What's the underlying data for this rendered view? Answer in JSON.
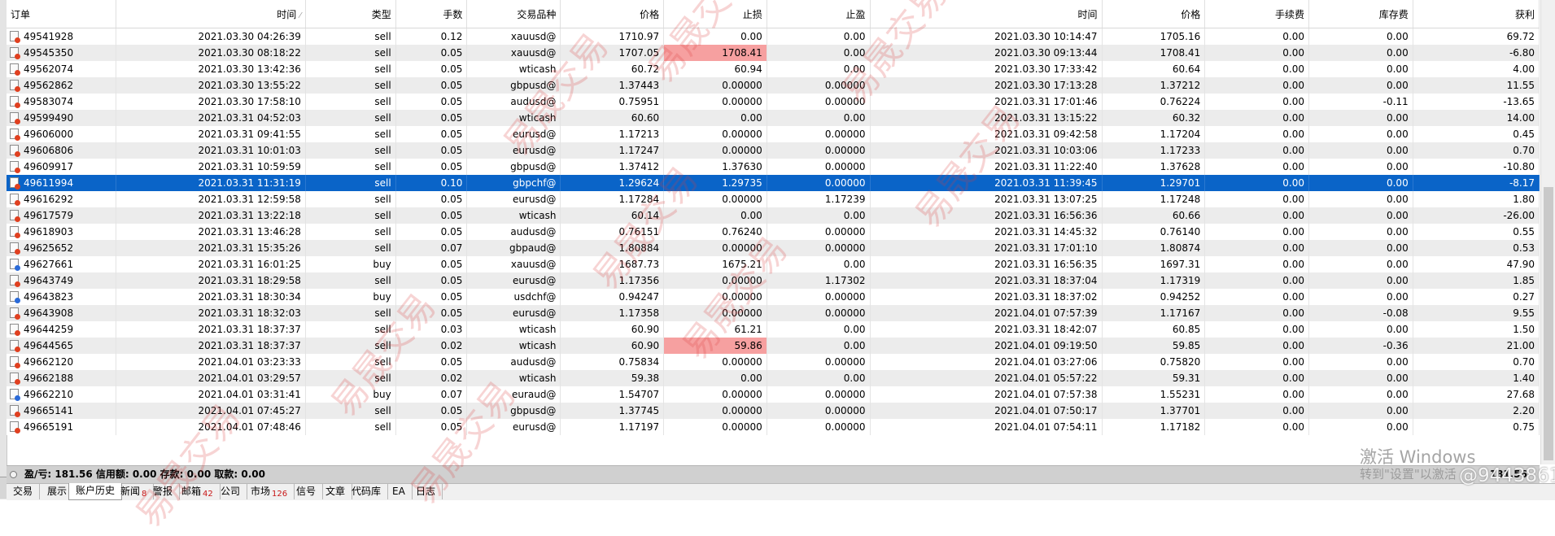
{
  "table": {
    "columns": [
      "订单",
      "时间",
      "类型",
      "手数",
      "交易品种",
      "价格",
      "止损",
      "止盈",
      "时间",
      "价格",
      "手续费",
      "库存费",
      "获利"
    ],
    "rows": [
      {
        "order": "49541928",
        "open_time": "2021.03.30 04:26:39",
        "type": "sell",
        "lots": "0.12",
        "symbol": "xauusd@",
        "open_price": "1710.97",
        "sl": "0.00",
        "tp": "0.00",
        "close_time": "2021.03.30 10:14:47",
        "close_price": "1705.16",
        "commission": "0.00",
        "swap": "0.00",
        "profit": "69.72"
      },
      {
        "order": "49545350",
        "open_time": "2021.03.30 08:18:22",
        "type": "sell",
        "lots": "0.05",
        "symbol": "xauusd@",
        "open_price": "1707.05",
        "sl": "1708.41",
        "tp": "0.00",
        "close_time": "2021.03.30 09:13:44",
        "close_price": "1708.41",
        "commission": "0.00",
        "swap": "0.00",
        "profit": "-6.80",
        "sl_hit": true
      },
      {
        "order": "49562074",
        "open_time": "2021.03.30 13:42:36",
        "type": "sell",
        "lots": "0.05",
        "symbol": "wticash",
        "open_price": "60.72",
        "sl": "60.94",
        "tp": "0.00",
        "close_time": "2021.03.30 17:33:42",
        "close_price": "60.64",
        "commission": "0.00",
        "swap": "0.00",
        "profit": "4.00"
      },
      {
        "order": "49562862",
        "open_time": "2021.03.30 13:55:22",
        "type": "sell",
        "lots": "0.05",
        "symbol": "gbpusd@",
        "open_price": "1.37443",
        "sl": "0.00000",
        "tp": "0.00000",
        "close_time": "2021.03.30 17:13:28",
        "close_price": "1.37212",
        "commission": "0.00",
        "swap": "0.00",
        "profit": "11.55"
      },
      {
        "order": "49583074",
        "open_time": "2021.03.30 17:58:10",
        "type": "sell",
        "lots": "0.05",
        "symbol": "audusd@",
        "open_price": "0.75951",
        "sl": "0.00000",
        "tp": "0.00000",
        "close_time": "2021.03.31 17:01:46",
        "close_price": "0.76224",
        "commission": "0.00",
        "swap": "-0.11",
        "profit": "-13.65"
      },
      {
        "order": "49599490",
        "open_time": "2021.03.31 04:52:03",
        "type": "sell",
        "lots": "0.05",
        "symbol": "wticash",
        "open_price": "60.60",
        "sl": "0.00",
        "tp": "0.00",
        "close_time": "2021.03.31 13:15:22",
        "close_price": "60.32",
        "commission": "0.00",
        "swap": "0.00",
        "profit": "14.00"
      },
      {
        "order": "49606000",
        "open_time": "2021.03.31 09:41:55",
        "type": "sell",
        "lots": "0.05",
        "symbol": "eurusd@",
        "open_price": "1.17213",
        "sl": "0.00000",
        "tp": "0.00000",
        "close_time": "2021.03.31 09:42:58",
        "close_price": "1.17204",
        "commission": "0.00",
        "swap": "0.00",
        "profit": "0.45"
      },
      {
        "order": "49606806",
        "open_time": "2021.03.31 10:01:03",
        "type": "sell",
        "lots": "0.05",
        "symbol": "eurusd@",
        "open_price": "1.17247",
        "sl": "0.00000",
        "tp": "0.00000",
        "close_time": "2021.03.31 10:03:06",
        "close_price": "1.17233",
        "commission": "0.00",
        "swap": "0.00",
        "profit": "0.70"
      },
      {
        "order": "49609917",
        "open_time": "2021.03.31 10:59:59",
        "type": "sell",
        "lots": "0.05",
        "symbol": "gbpusd@",
        "open_price": "1.37412",
        "sl": "1.37630",
        "tp": "0.00000",
        "close_time": "2021.03.31 11:22:40",
        "close_price": "1.37628",
        "commission": "0.00",
        "swap": "0.00",
        "profit": "-10.80"
      },
      {
        "order": "49611994",
        "open_time": "2021.03.31 11:31:19",
        "type": "sell",
        "lots": "0.10",
        "symbol": "gbpchf@",
        "open_price": "1.29624",
        "sl": "1.29735",
        "tp": "0.00000",
        "close_time": "2021.03.31 11:39:45",
        "close_price": "1.29701",
        "commission": "0.00",
        "swap": "0.00",
        "profit": "-8.17",
        "selected": true
      },
      {
        "order": "49616292",
        "open_time": "2021.03.31 12:59:58",
        "type": "sell",
        "lots": "0.05",
        "symbol": "eurusd@",
        "open_price": "1.17284",
        "sl": "0.00000",
        "tp": "1.17239",
        "close_time": "2021.03.31 13:07:25",
        "close_price": "1.17248",
        "commission": "0.00",
        "swap": "0.00",
        "profit": "1.80"
      },
      {
        "order": "49617579",
        "open_time": "2021.03.31 13:22:18",
        "type": "sell",
        "lots": "0.05",
        "symbol": "wticash",
        "open_price": "60.14",
        "sl": "0.00",
        "tp": "0.00",
        "close_time": "2021.03.31 16:56:36",
        "close_price": "60.66",
        "commission": "0.00",
        "swap": "0.00",
        "profit": "-26.00"
      },
      {
        "order": "49618903",
        "open_time": "2021.03.31 13:46:28",
        "type": "sell",
        "lots": "0.05",
        "symbol": "audusd@",
        "open_price": "0.76151",
        "sl": "0.76240",
        "tp": "0.00000",
        "close_time": "2021.03.31 14:45:32",
        "close_price": "0.76140",
        "commission": "0.00",
        "swap": "0.00",
        "profit": "0.55"
      },
      {
        "order": "49625652",
        "open_time": "2021.03.31 15:35:26",
        "type": "sell",
        "lots": "0.07",
        "symbol": "gbpaud@",
        "open_price": "1.80884",
        "sl": "0.00000",
        "tp": "0.00000",
        "close_time": "2021.03.31 17:01:10",
        "close_price": "1.80874",
        "commission": "0.00",
        "swap": "0.00",
        "profit": "0.53"
      },
      {
        "order": "49627661",
        "open_time": "2021.03.31 16:01:25",
        "type": "buy",
        "lots": "0.05",
        "symbol": "xauusd@",
        "open_price": "1687.73",
        "sl": "1675.21",
        "tp": "0.00",
        "close_time": "2021.03.31 16:56:35",
        "close_price": "1697.31",
        "commission": "0.00",
        "swap": "0.00",
        "profit": "47.90"
      },
      {
        "order": "49643749",
        "open_time": "2021.03.31 18:29:58",
        "type": "sell",
        "lots": "0.05",
        "symbol": "eurusd@",
        "open_price": "1.17356",
        "sl": "0.00000",
        "tp": "1.17302",
        "close_time": "2021.03.31 18:37:04",
        "close_price": "1.17319",
        "commission": "0.00",
        "swap": "0.00",
        "profit": "1.85"
      },
      {
        "order": "49643823",
        "open_time": "2021.03.31 18:30:34",
        "type": "buy",
        "lots": "0.05",
        "symbol": "usdchf@",
        "open_price": "0.94247",
        "sl": "0.00000",
        "tp": "0.00000",
        "close_time": "2021.03.31 18:37:02",
        "close_price": "0.94252",
        "commission": "0.00",
        "swap": "0.00",
        "profit": "0.27"
      },
      {
        "order": "49643908",
        "open_time": "2021.03.31 18:32:03",
        "type": "sell",
        "lots": "0.05",
        "symbol": "eurusd@",
        "open_price": "1.17358",
        "sl": "0.00000",
        "tp": "0.00000",
        "close_time": "2021.04.01 07:57:39",
        "close_price": "1.17167",
        "commission": "0.00",
        "swap": "-0.08",
        "profit": "9.55"
      },
      {
        "order": "49644259",
        "open_time": "2021.03.31 18:37:37",
        "type": "sell",
        "lots": "0.03",
        "symbol": "wticash",
        "open_price": "60.90",
        "sl": "61.21",
        "tp": "0.00",
        "close_time": "2021.03.31 18:42:07",
        "close_price": "60.85",
        "commission": "0.00",
        "swap": "0.00",
        "profit": "1.50"
      },
      {
        "order": "49644565",
        "open_time": "2021.03.31 18:37:37",
        "type": "sell",
        "lots": "0.02",
        "symbol": "wticash",
        "open_price": "60.90",
        "sl": "59.86",
        "tp": "0.00",
        "close_time": "2021.04.01 09:19:50",
        "close_price": "59.85",
        "commission": "0.00",
        "swap": "-0.36",
        "profit": "21.00",
        "sl_hit": true
      },
      {
        "order": "49662120",
        "open_time": "2021.04.01 03:23:33",
        "type": "sell",
        "lots": "0.05",
        "symbol": "audusd@",
        "open_price": "0.75834",
        "sl": "0.00000",
        "tp": "0.00000",
        "close_time": "2021.04.01 03:27:06",
        "close_price": "0.75820",
        "commission": "0.00",
        "swap": "0.00",
        "profit": "0.70"
      },
      {
        "order": "49662188",
        "open_time": "2021.04.01 03:29:57",
        "type": "sell",
        "lots": "0.02",
        "symbol": "wticash",
        "open_price": "59.38",
        "sl": "0.00",
        "tp": "0.00",
        "close_time": "2021.04.01 05:57:22",
        "close_price": "59.31",
        "commission": "0.00",
        "swap": "0.00",
        "profit": "1.40"
      },
      {
        "order": "49662210",
        "open_time": "2021.04.01 03:31:41",
        "type": "buy",
        "lots": "0.07",
        "symbol": "euraud@",
        "open_price": "1.54707",
        "sl": "0.00000",
        "tp": "0.00000",
        "close_time": "2021.04.01 07:57:38",
        "close_price": "1.55231",
        "commission": "0.00",
        "swap": "0.00",
        "profit": "27.68"
      },
      {
        "order": "49665141",
        "open_time": "2021.04.01 07:45:27",
        "type": "sell",
        "lots": "0.05",
        "symbol": "gbpusd@",
        "open_price": "1.37745",
        "sl": "0.00000",
        "tp": "0.00000",
        "close_time": "2021.04.01 07:50:17",
        "close_price": "1.37701",
        "commission": "0.00",
        "swap": "0.00",
        "profit": "2.20"
      },
      {
        "order": "49665191",
        "open_time": "2021.04.01 07:48:46",
        "type": "sell",
        "lots": "0.05",
        "symbol": "eurusd@",
        "open_price": "1.17197",
        "sl": "0.00000",
        "tp": "0.00000",
        "close_time": "2021.04.01 07:54:11",
        "close_price": "1.17182",
        "commission": "0.00",
        "swap": "0.00",
        "profit": "0.75"
      }
    ]
  },
  "summary": {
    "text": "盈/亏: 181.56  信用额: 0.00  存款: 0.00  取款: 0.00",
    "total": "181.56"
  },
  "tabs": [
    {
      "label": "交易"
    },
    {
      "label": "展示"
    },
    {
      "label": "账户历史",
      "active": true
    },
    {
      "label": "新闻",
      "badge": "8"
    },
    {
      "label": "警报"
    },
    {
      "label": "邮箱",
      "badge": "42"
    },
    {
      "label": "公司"
    },
    {
      "label": "市场",
      "badge": "126"
    },
    {
      "label": "信号"
    },
    {
      "label": "文章"
    },
    {
      "label": "代码库"
    },
    {
      "label": "EA"
    },
    {
      "label": "日志"
    }
  ],
  "overlays": {
    "watermark": "易晟交易",
    "windows_activation": "激活 Windows",
    "windows_activation_sub": "转到\"设置\"以激活",
    "weibo_handle": "@9443861"
  },
  "colors": {
    "selected_row": "#0a64c8",
    "sl_hit_highlight": "#f6a0a0",
    "watermark": "#dc3c3c"
  }
}
